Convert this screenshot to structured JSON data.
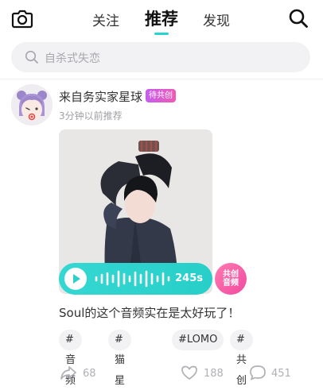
{
  "header": {
    "tabs": [
      {
        "label": "关注"
      },
      {
        "label": "推荐"
      },
      {
        "label": "发现"
      }
    ],
    "camera_icon": "camera-icon",
    "search_icon": "search-icon",
    "accent_color": "#25d4d0"
  },
  "search": {
    "placeholder": "自杀式失恋"
  },
  "post": {
    "author": "来自务实家星球",
    "badge": "待共创",
    "time": "3分钟以前推荐",
    "audio": {
      "duration": "245s",
      "cocreate_label_line1": "共创",
      "cocreate_label_line2": "音频"
    },
    "text": "Soul的这个音频实在是太好玩了！",
    "tags": [
      "#音频",
      "#猫星人",
      "#LOMO",
      "#共创"
    ],
    "actions": {
      "share_count": "68",
      "like_count": "188",
      "comment_count": "451"
    }
  }
}
